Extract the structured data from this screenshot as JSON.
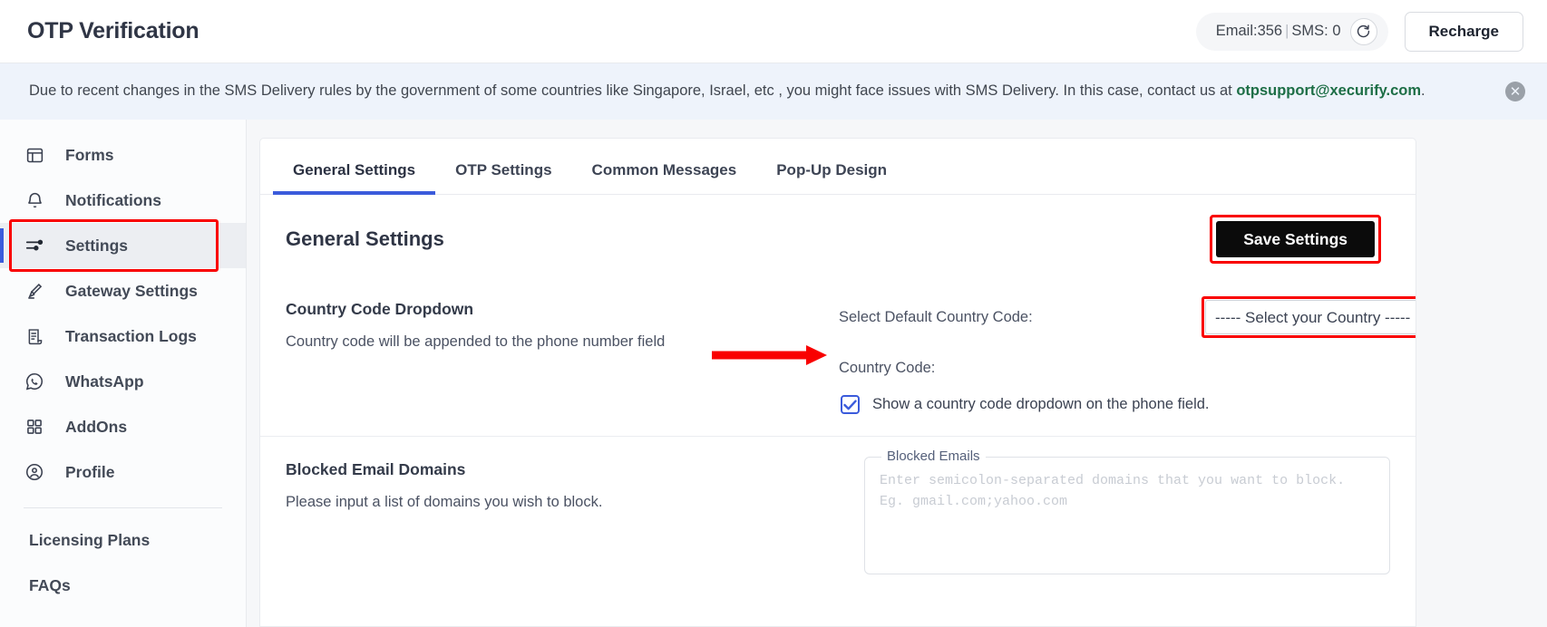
{
  "header": {
    "title": "OTP Verification",
    "credits": {
      "email_label": "Email:356",
      "divider": "|",
      "sms_label": "SMS: 0",
      "refresh_icon": "refresh-icon"
    },
    "recharge_label": "Recharge"
  },
  "notice": {
    "text_before": "Due to recent changes in the SMS Delivery rules by the government of some countries like Singapore, Israel, etc , you might face issues with SMS Delivery. In this case, contact us at ",
    "email": "otpsupport@xecurify.com",
    "text_after": ".",
    "close_icon": "close-icon",
    "background": "#eef3fb",
    "email_color": "#1d6e46"
  },
  "sidebar": {
    "items": [
      {
        "label": "Forms",
        "icon": "forms-icon",
        "active": false
      },
      {
        "label": "Notifications",
        "icon": "bell-icon",
        "active": false
      },
      {
        "label": "Settings",
        "icon": "sliders-icon",
        "active": true
      },
      {
        "label": "Gateway Settings",
        "icon": "brush-icon",
        "active": false
      },
      {
        "label": "Transaction Logs",
        "icon": "receipt-icon",
        "active": false
      },
      {
        "label": "WhatsApp",
        "icon": "whatsapp-icon",
        "active": false
      },
      {
        "label": "AddOns",
        "icon": "grid-icon",
        "active": false
      },
      {
        "label": "Profile",
        "icon": "user-circle-icon",
        "active": false
      }
    ],
    "plain_items": [
      {
        "label": "Licensing Plans"
      },
      {
        "label": "FAQs"
      }
    ],
    "active_accent": "#3b5bdb",
    "highlight_color": "#f90000"
  },
  "main": {
    "tabs": [
      {
        "label": "General Settings",
        "active": true
      },
      {
        "label": "OTP Settings",
        "active": false
      },
      {
        "label": "Common Messages",
        "active": false
      },
      {
        "label": "Pop-Up Design",
        "active": false
      }
    ],
    "section_title": "General Settings",
    "save_label": "Save Settings",
    "country_section": {
      "title": "Country Code Dropdown",
      "description": "Country code will be appended to the phone number field",
      "select_label": "Select Default Country Code:",
      "select_value": "----- Select your Country -----",
      "country_code_label": "Country Code:",
      "checkbox_label": "Show a country code dropdown on the phone field.",
      "checkbox_checked": true
    },
    "blocked_section": {
      "title": "Blocked Email Domains",
      "description": "Please input a list of domains you wish to block.",
      "legend": "Blocked Emails",
      "placeholder": "Enter semicolon-separated domains that you want to block. Eg. gmail.com;yahoo.com"
    }
  },
  "colors": {
    "accent_blue": "#3b5bdb",
    "annotation_red": "#f90000",
    "save_button_bg": "#0b0b0b"
  }
}
